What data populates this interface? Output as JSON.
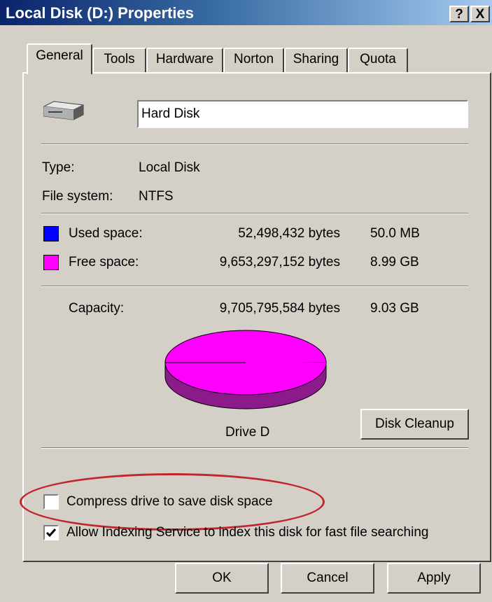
{
  "window": {
    "title": "Local Disk (D:) Properties",
    "help_label": "?",
    "close_label": "X"
  },
  "tabs": [
    {
      "label": "General",
      "active": true
    },
    {
      "label": "Tools",
      "active": false
    },
    {
      "label": "Hardware",
      "active": false
    },
    {
      "label": "Norton",
      "active": false
    },
    {
      "label": "Sharing",
      "active": false
    },
    {
      "label": "Quota",
      "active": false
    }
  ],
  "general": {
    "name_value": "Hard Disk",
    "type_label": "Type:",
    "type_value": "Local Disk",
    "fs_label": "File system:",
    "fs_value": "NTFS",
    "used": {
      "label": "Used space:",
      "bytes": "52,498,432 bytes",
      "size": "50.0 MB",
      "color": "#0000ff"
    },
    "free": {
      "label": "Free space:",
      "bytes": "9,653,297,152 bytes",
      "size": "8.99 GB",
      "color": "#ff00ff"
    },
    "capacity": {
      "label": "Capacity:",
      "bytes": "9,705,795,584 bytes",
      "size": "9.03 GB"
    },
    "drive_label": "Drive D",
    "cleanup_label": "Disk Cleanup",
    "compress": {
      "label": "Compress drive to save disk space",
      "checked": false
    },
    "indexing": {
      "label": "Allow Indexing Service to index this disk for fast file searching",
      "checked": true
    }
  },
  "chart_data": {
    "type": "pie",
    "categories": [
      "Used space",
      "Free space"
    ],
    "values": [
      52498432,
      9653297152
    ],
    "colors": [
      "#0000ff",
      "#ff00ff"
    ]
  },
  "buttons": {
    "ok": "OK",
    "cancel": "Cancel",
    "apply": "Apply"
  }
}
